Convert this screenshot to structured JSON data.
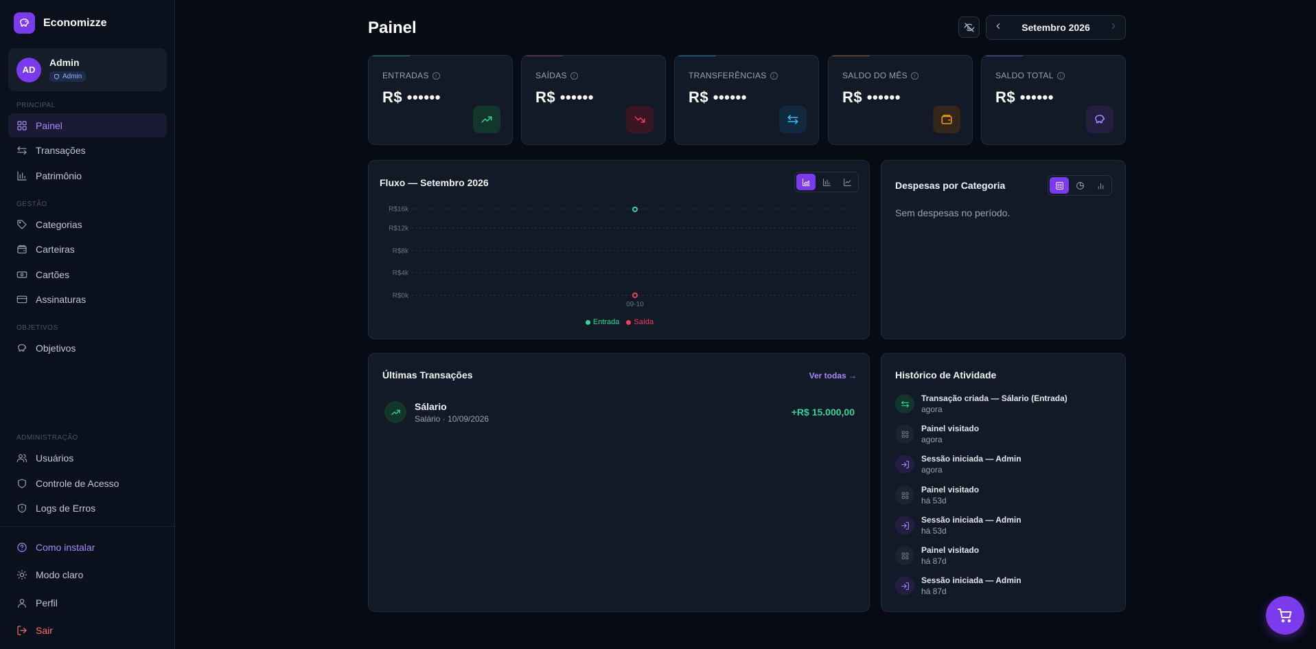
{
  "app": {
    "name": "Economizze"
  },
  "user": {
    "initials": "AD",
    "name": "Admin",
    "role": "Admin"
  },
  "sidebar": {
    "sections": {
      "principal": "PRINCIPAL",
      "gestao": "GESTÃO",
      "objetivos": "OBJETIVOS",
      "administracao": "ADMINISTRAÇÃO"
    },
    "items": {
      "painel": "Painel",
      "transacoes": "Transações",
      "patrimonio": "Patrimônio",
      "categorias": "Categorias",
      "carteiras": "Carteiras",
      "cartoes": "Cartões",
      "assinaturas": "Assinaturas",
      "objetivos": "Objetivos",
      "usuarios": "Usuários",
      "controle_acesso": "Controle de Acesso",
      "logs_erros": "Logs de Erros"
    },
    "footer": {
      "como_instalar": "Como instalar",
      "modo_claro": "Modo claro",
      "perfil": "Perfil",
      "sair": "Sair"
    }
  },
  "header": {
    "title": "Painel",
    "month": "Setembro 2026"
  },
  "stats": [
    {
      "label": "ENTRADAS",
      "value": "R$ ••••••",
      "icon": "trending-up-icon",
      "color": "#34d399"
    },
    {
      "label": "SAÍDAS",
      "value": "R$ ••••••",
      "icon": "trending-down-icon",
      "color": "#f43f5e"
    },
    {
      "label": "TRANSFERÊNCIAS",
      "value": "R$ ••••••",
      "icon": "arrows-exchange-icon",
      "color": "#38bdf8"
    },
    {
      "label": "SALDO DO MÊS",
      "value": "R$ ••••••",
      "icon": "wallet-icon",
      "color": "#f59e0b"
    },
    {
      "label": "SALDO TOTAL",
      "value": "R$ ••••••",
      "icon": "piggy-bank-icon",
      "color": "#a78bfa"
    }
  ],
  "flow": {
    "title": "Fluxo — Setembro 2026",
    "legend": {
      "entrada": "Entrada",
      "saida": "Saída"
    }
  },
  "chart_data": {
    "type": "area",
    "x": [
      "09-10"
    ],
    "series": [
      {
        "name": "Entrada",
        "values": [
          15000
        ],
        "color": "#34d399"
      },
      {
        "name": "Saída",
        "values": [
          0
        ],
        "color": "#f43f5e"
      }
    ],
    "yticks": [
      "R$0k",
      "R$4k",
      "R$8k",
      "R$12k",
      "R$16k"
    ],
    "ylim": [
      0,
      16000
    ],
    "grid": true,
    "legend": "bottom"
  },
  "categories_panel": {
    "title": "Despesas por Categoria",
    "empty": "Sem despesas no período."
  },
  "transactions": {
    "title": "Últimas Transações",
    "view_all": "Ver todas →",
    "items": [
      {
        "name": "Sálario",
        "sub": "Salário · 10/09/2026",
        "amount": "+R$ 15.000,00"
      }
    ]
  },
  "activity": {
    "title": "Histórico de Atividade",
    "items": [
      {
        "title": "Transação criada — Sálario (Entrada)",
        "time": "agora",
        "icon": "arrows-exchange-icon"
      },
      {
        "title": "Painel visitado",
        "time": "agora",
        "icon": "grid-icon"
      },
      {
        "title": "Sessão iniciada — Admin",
        "time": "agora",
        "icon": "login-icon"
      },
      {
        "title": "Painel visitado",
        "time": "há 53d",
        "icon": "grid-icon"
      },
      {
        "title": "Sessão iniciada — Admin",
        "time": "há 53d",
        "icon": "login-icon"
      },
      {
        "title": "Painel visitado",
        "time": "há 87d",
        "icon": "grid-icon"
      },
      {
        "title": "Sessão iniciada — Admin",
        "time": "há 87d",
        "icon": "login-icon"
      }
    ]
  }
}
